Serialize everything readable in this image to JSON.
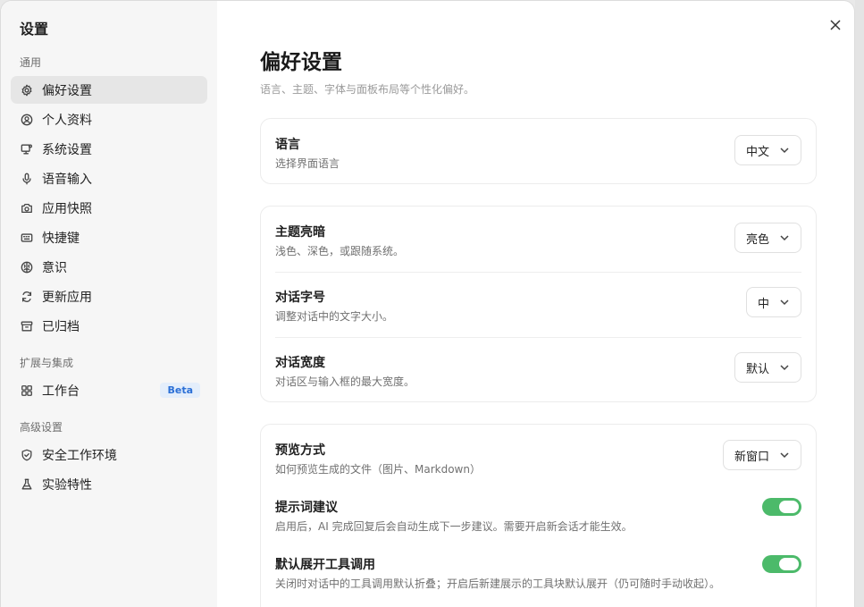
{
  "sidebar": {
    "title": "设置",
    "sections": {
      "general": "通用",
      "extensions": "扩展与集成",
      "advanced": "高级设置"
    },
    "items": [
      {
        "label": "偏好设置",
        "icon": "gear-icon",
        "active": true
      },
      {
        "label": "个人资料",
        "icon": "user-circle-icon"
      },
      {
        "label": "系统设置",
        "icon": "monitor-gear-icon"
      },
      {
        "label": "语音输入",
        "icon": "microphone-icon"
      },
      {
        "label": "应用快照",
        "icon": "camera-icon"
      },
      {
        "label": "快捷键",
        "icon": "keyboard-icon"
      },
      {
        "label": "意识",
        "icon": "brain-icon"
      },
      {
        "label": "更新应用",
        "icon": "refresh-icon"
      },
      {
        "label": "已归档",
        "icon": "archive-icon"
      },
      {
        "label": "工作台",
        "icon": "grid-icon",
        "badge": "Beta"
      },
      {
        "label": "安全工作环境",
        "icon": "shield-icon"
      },
      {
        "label": "实验特性",
        "icon": "flask-icon"
      }
    ]
  },
  "main": {
    "title": "偏好设置",
    "description": "语言、主题、字体与面板布局等个性化偏好。",
    "language": {
      "label": "语言",
      "desc": "选择界面语言",
      "value": "中文"
    },
    "theme": {
      "label": "主题亮暗",
      "desc": "浅色、深色，或跟随系统。",
      "value": "亮色"
    },
    "font_size": {
      "label": "对话字号",
      "desc": "调整对话中的文字大小。",
      "value": "中"
    },
    "width": {
      "label": "对话宽度",
      "desc": "对话区与输入框的最大宽度。",
      "value": "默认"
    },
    "preview": {
      "label": "预览方式",
      "desc": "如何预览生成的文件（图片、Markdown）",
      "value": "新窗口"
    },
    "prompt_suggest": {
      "label": "提示词建议",
      "desc": "启用后，AI 完成回复后会自动生成下一步建议。需要开启新会话才能生效。",
      "enabled": true
    },
    "tool_expand": {
      "label": "默认展开工具调用",
      "desc": "关闭时对话中的工具调用默认折叠；开启后新建展示的工具块默认展开（仍可随时手动收起）。",
      "enabled": true
    }
  },
  "colors": {
    "toggle_on": "#4cba6a",
    "beta_text": "#2b6fd6",
    "sidebar_bg": "#f6f6f6",
    "active_item": "#e6e6e6"
  }
}
